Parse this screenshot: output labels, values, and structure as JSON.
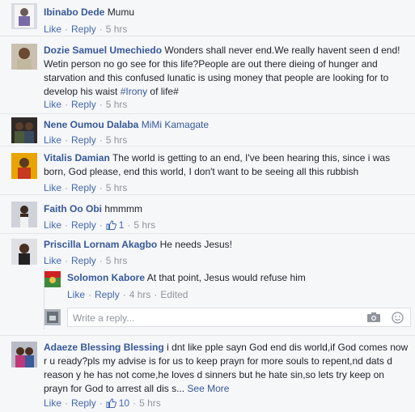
{
  "comments": [
    {
      "name": "Ibinabo Dede",
      "text": "Mumu",
      "like": "Like",
      "reply": "Reply",
      "time": "5 hrs"
    },
    {
      "name": "Dozie Samuel Umechiedo",
      "text": "Wonders shall never end.We really havent seen d end! Wetin person no go see for this life?People are out there dieing of hunger and starvation and this confused lunatic is using money that people are looking for to develop his waist ",
      "hashtag": "#Irony",
      "text_after": " of life#",
      "like": "Like",
      "reply": "Reply",
      "time": "5 hrs"
    },
    {
      "name": "Nene Oumou Dalaba",
      "tag": "MiMi Kamagate",
      "like": "Like",
      "reply": "Reply",
      "time": "5 hrs"
    },
    {
      "name": "Vitalis Damian",
      "text": "The world is getting to an end, I've been hearing this, since i was born, God please, end this world, I don't want to be seeing all this rubbish",
      "like": "Like",
      "reply": "Reply",
      "time": "5 hrs"
    },
    {
      "name": "Faith Oo Obi",
      "text": "hmmmm",
      "like": "Like",
      "reply": "Reply",
      "likes_count": "1",
      "time": "5 hrs"
    },
    {
      "name": "Priscilla Lornam Akagbo",
      "text": "He needs Jesus!",
      "like": "Like",
      "reply": "Reply",
      "time": "5 hrs"
    },
    {
      "name": "Adaeze Blessing Blessing",
      "text": "i dnt like pple sayn God end dis world,if God comes now r u ready?pls my advise is for us to keep prayn for more souls to repent,nd dats d reason y he has not come,he loves d sinners but he hate sin,so lets try keep on prayn for God to arrest all dis s...",
      "see_more": "See More",
      "like": "Like",
      "reply": "Reply",
      "likes_count": "10",
      "time": "5 hrs"
    }
  ],
  "reply": {
    "name": "Solomon Kabore",
    "text": "At that point, Jesus would refuse him",
    "like": "Like",
    "reply": "Reply",
    "time": "4 hrs",
    "edited": "Edited"
  },
  "reply_input": {
    "placeholder": "Write a reply..."
  },
  "colors": {
    "link": "#365899",
    "action": "#4267b2",
    "meta": "#90949c",
    "bg": "#f6f7f9"
  }
}
